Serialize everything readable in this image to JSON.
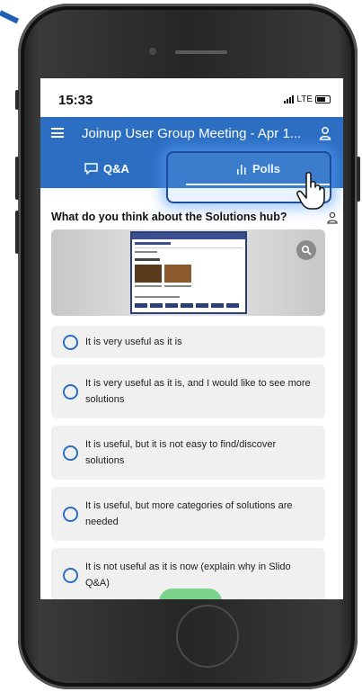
{
  "status_bar": {
    "time": "15:33",
    "network": "LTE"
  },
  "app_bar": {
    "title": "Joinup User Group Meeting - Apr 1...",
    "menu_icon": "hamburger-icon",
    "user_icon": "user-icon"
  },
  "tabs": [
    {
      "label": "Q&A",
      "icon": "chat-icon",
      "active": false
    },
    {
      "label": "Polls",
      "icon": "bar-chart-icon",
      "active": true
    }
  ],
  "poll": {
    "question": "What do you think about the Solutions hub?",
    "options": [
      {
        "label": "It is very useful as it is"
      },
      {
        "label": "It is very useful as it is, and I would like to see more solutions"
      },
      {
        "label": "It is useful, but it is not easy to find/discover solutions"
      },
      {
        "label": "It is useful, but more categories of solutions are needed"
      },
      {
        "label": "It is not useful as it is now (explain why in Slido Q&A)"
      }
    ]
  },
  "colors": {
    "accent": "#2c6ec2",
    "highlight": "#1f4b9c",
    "vote_button": "#7ad28b",
    "option_bg": "#f0f0f0"
  }
}
